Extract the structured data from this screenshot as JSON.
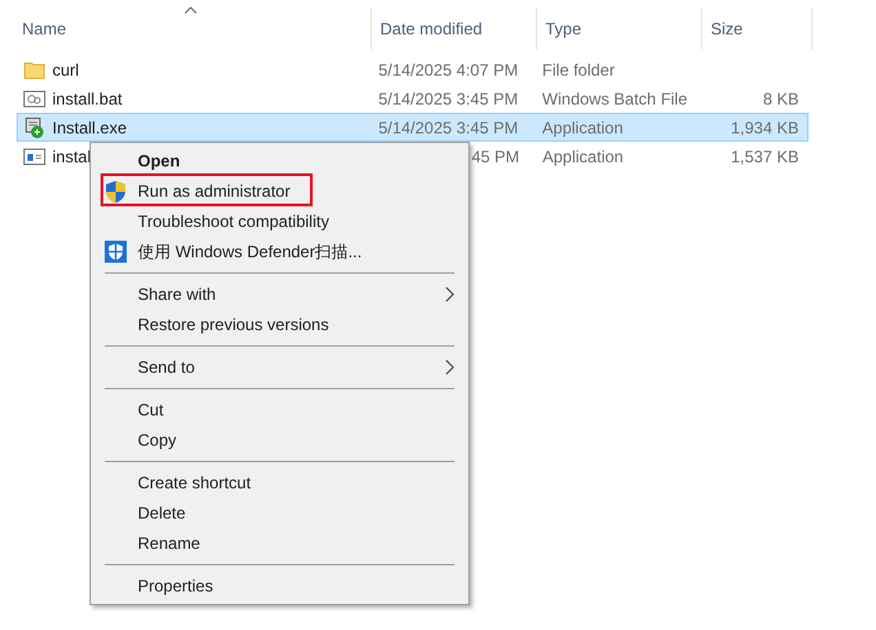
{
  "columns": [
    {
      "label": "Name"
    },
    {
      "label": "Date modified"
    },
    {
      "label": "Type"
    },
    {
      "label": "Size"
    }
  ],
  "rows": [
    {
      "kind": "folder",
      "name": "curl",
      "date": "5/14/2025 4:07 PM",
      "type": "File folder",
      "size": "",
      "selected": false
    },
    {
      "kind": "batch",
      "name": "install.bat",
      "date": "5/14/2025 3:45 PM",
      "type": "Windows Batch File",
      "size": "8 KB",
      "selected": false
    },
    {
      "kind": "setup",
      "name": "Install.exe",
      "date": "5/14/2025 3:45 PM",
      "type": "Application",
      "size": "1,934 KB",
      "selected": true
    },
    {
      "kind": "app",
      "name": "instal",
      "date": "45 PM",
      "type": "Application",
      "size": "1,537 KB",
      "selected": false
    }
  ],
  "context_menu": {
    "groups": [
      [
        {
          "label": "Open",
          "bold": true,
          "kind": "plain",
          "submenu": false,
          "highlighted": false
        },
        {
          "label": "Run as administrator",
          "bold": false,
          "kind": "shield",
          "submenu": false,
          "highlighted": true
        },
        {
          "label": "Troubleshoot compatibility",
          "bold": false,
          "kind": "plain",
          "submenu": false,
          "highlighted": false
        },
        {
          "label": "使用 Windows Defender扫描...",
          "bold": false,
          "kind": "defender",
          "submenu": false,
          "highlighted": false
        }
      ],
      [
        {
          "label": "Share with",
          "bold": false,
          "kind": "plain",
          "submenu": true,
          "highlighted": false
        },
        {
          "label": "Restore previous versions",
          "bold": false,
          "kind": "plain",
          "submenu": false,
          "highlighted": false
        }
      ],
      [
        {
          "label": "Send to",
          "bold": false,
          "kind": "plain",
          "submenu": true,
          "highlighted": false
        }
      ],
      [
        {
          "label": "Cut",
          "bold": false,
          "kind": "plain",
          "submenu": false,
          "highlighted": false
        },
        {
          "label": "Copy",
          "bold": false,
          "kind": "plain",
          "submenu": false,
          "highlighted": false
        }
      ],
      [
        {
          "label": "Create shortcut",
          "bold": false,
          "kind": "plain",
          "submenu": false,
          "highlighted": false
        },
        {
          "label": "Delete",
          "bold": false,
          "kind": "plain",
          "submenu": false,
          "highlighted": false
        },
        {
          "label": "Rename",
          "bold": false,
          "kind": "plain",
          "submenu": false,
          "highlighted": false
        }
      ],
      [
        {
          "label": "Properties",
          "bold": false,
          "kind": "plain",
          "submenu": false,
          "highlighted": false
        }
      ]
    ]
  }
}
